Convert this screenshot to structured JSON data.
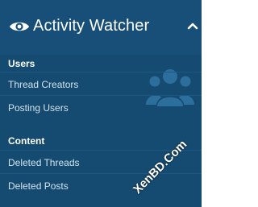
{
  "header": {
    "title": "Activity Watcher",
    "icon": "eye-icon",
    "toggle_icon": "chevron-up-icon"
  },
  "sections": [
    {
      "heading": "Users",
      "items": [
        "Thread Creators",
        "Posting Users"
      ]
    },
    {
      "heading": "Content",
      "items": [
        "Deleted Threads",
        "Deleted Posts"
      ]
    }
  ],
  "background_icon": "users-group-icon",
  "watermark": "XenBD.Com",
  "colors": {
    "panel_bg": "#154b70",
    "header_bg": "#174f78",
    "link_text": "#d2e2ef",
    "heading_text": "#ffffff"
  }
}
